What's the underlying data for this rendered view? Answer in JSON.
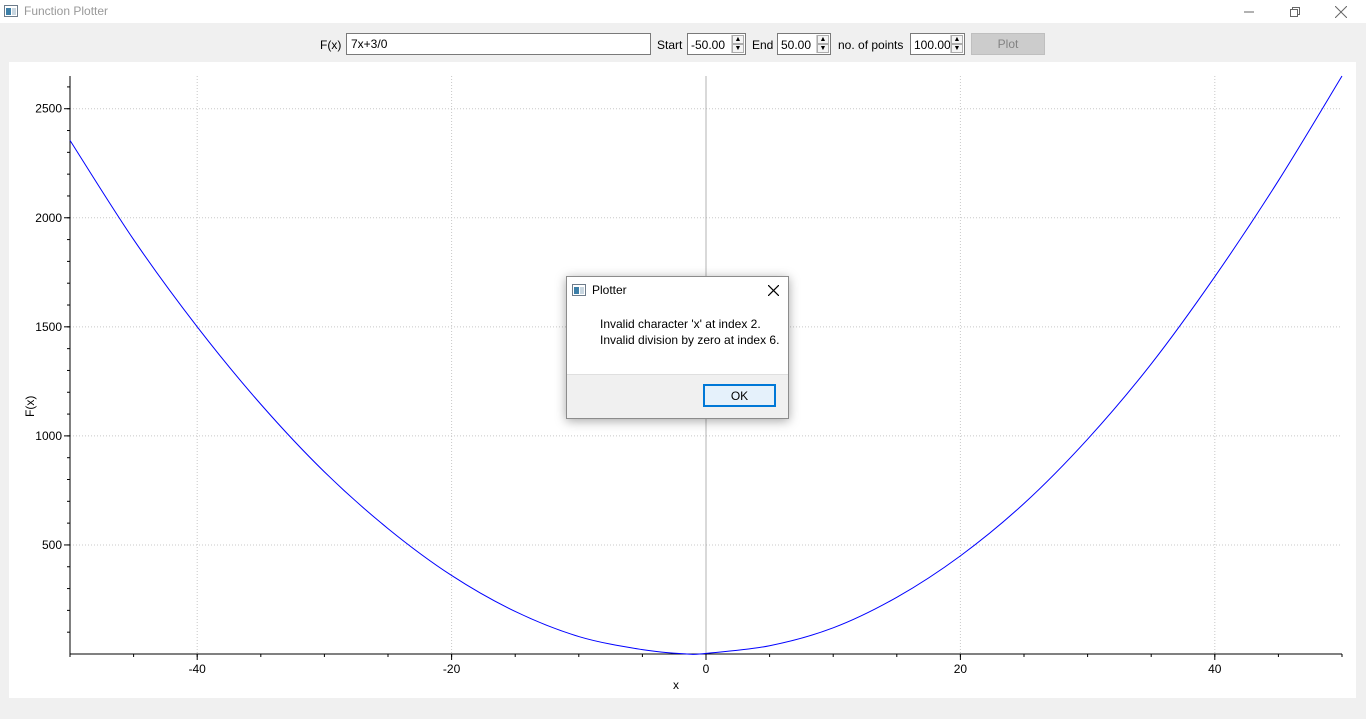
{
  "window": {
    "title": "Function Plotter"
  },
  "toolbar": {
    "fx_label": "F(x)",
    "fx_value": "7x+3/0",
    "start_label": "Start",
    "start_value": "-50.00",
    "end_label": "End",
    "end_value": "50.00",
    "points_label": "no. of points",
    "points_value": "100.00",
    "plot_label": "Plot"
  },
  "chart_data": {
    "type": "line",
    "xlabel": "x",
    "ylabel": "F(x)",
    "xlim": [
      -50,
      50
    ],
    "ylim": [
      0,
      2650
    ],
    "x_ticks": [
      -40,
      -20,
      0,
      20,
      40
    ],
    "y_ticks": [
      500,
      1000,
      1500,
      2000,
      2500
    ],
    "grid": true,
    "line_color": "#0000ff",
    "series": [
      {
        "x": [
          -50,
          -45,
          -40,
          -35,
          -30,
          -25,
          -20,
          -15,
          -10,
          -5,
          -1.5,
          0,
          5,
          10,
          15,
          20,
          25,
          30,
          35,
          40,
          45,
          50
        ],
        "values": [
          2355,
          1900,
          1500,
          1145,
          835,
          575,
          360,
          195,
          80,
          20,
          0,
          3,
          38,
          120,
          260,
          450,
          690,
          985,
          1330,
          1730,
          2170,
          2650
        ]
      }
    ]
  },
  "dialog": {
    "title": "Plotter",
    "line1": "Invalid character 'x' at index 2.",
    "line2": "Invalid division by zero at index 6.",
    "ok_label": "OK"
  }
}
